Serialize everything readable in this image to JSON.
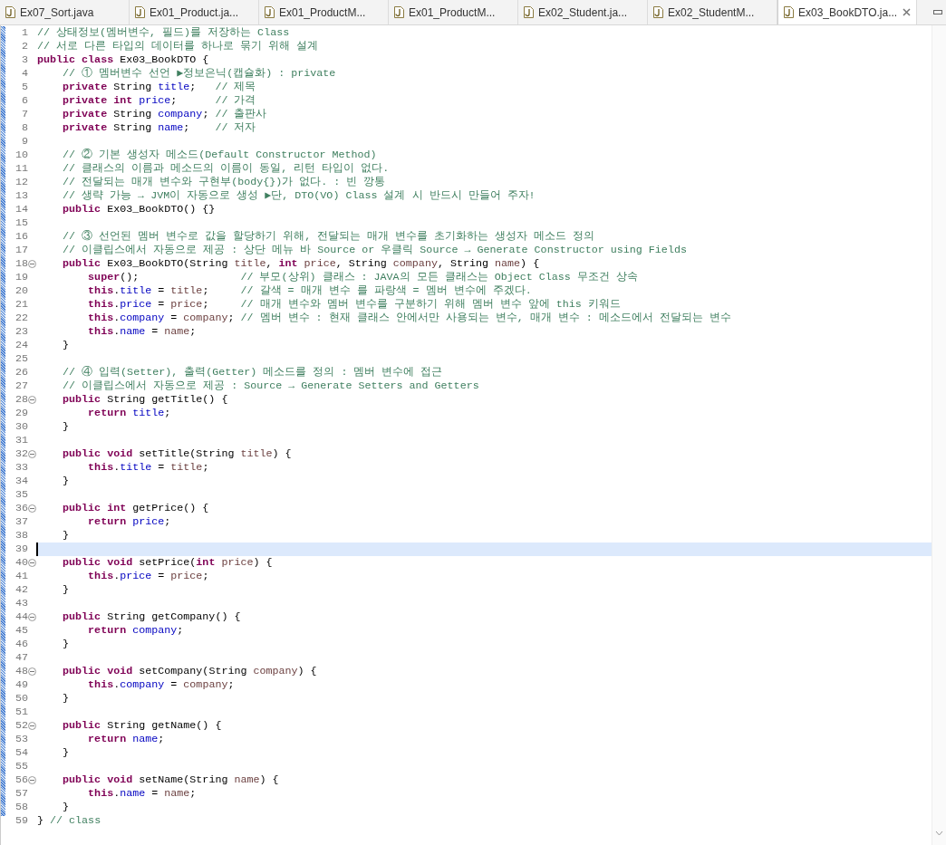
{
  "tabs": [
    {
      "label": "Ex07_Sort.java",
      "selected": false
    },
    {
      "label": "Ex01_Product.ja...",
      "selected": false
    },
    {
      "label": "Ex01_ProductM...",
      "selected": false
    },
    {
      "label": "Ex01_ProductM...",
      "selected": false
    },
    {
      "label": "Ex02_Student.ja...",
      "selected": false
    },
    {
      "label": "Ex02_StudentM...",
      "selected": false
    },
    {
      "label": "Ex03_BookDTO.ja...",
      "selected": true
    }
  ],
  "editor": {
    "lines": [
      {
        "number": "1",
        "fold": false,
        "current": false,
        "tokens": [
          {
            "kind": "comment",
            "text": "// 상태정보(멤버변수, 필드)를 저장하는 Class"
          }
        ]
      },
      {
        "number": "2",
        "fold": false,
        "current": false,
        "tokens": [
          {
            "kind": "comment",
            "text": "// 서로 다른 타입의 데이터를 하나로 묶기 위해 설계"
          }
        ]
      },
      {
        "number": "3",
        "fold": false,
        "current": false,
        "tokens": [
          {
            "kind": "keyword",
            "text": "public class"
          },
          {
            "kind": "plain",
            "text": " Ex03_BookDTO {"
          }
        ]
      },
      {
        "number": "4",
        "fold": false,
        "current": false,
        "tokens": [
          {
            "kind": "comment",
            "text": "    // ① 멤버변수 선언 ▶정보은닉(캡슐화) : private"
          }
        ]
      },
      {
        "number": "5",
        "fold": false,
        "current": false,
        "tokens": [
          {
            "kind": "keyword",
            "text": "    private"
          },
          {
            "kind": "plain",
            "text": " String "
          },
          {
            "kind": "field",
            "text": "title"
          },
          {
            "kind": "plain",
            "text": ";   "
          },
          {
            "kind": "comment",
            "text": "// 제목"
          }
        ]
      },
      {
        "number": "6",
        "fold": false,
        "current": false,
        "tokens": [
          {
            "kind": "keyword",
            "text": "    private int"
          },
          {
            "kind": "field",
            "text": " price"
          },
          {
            "kind": "plain",
            "text": ";      "
          },
          {
            "kind": "comment",
            "text": "// 가격"
          }
        ]
      },
      {
        "number": "7",
        "fold": false,
        "current": false,
        "tokens": [
          {
            "kind": "keyword",
            "text": "    private"
          },
          {
            "kind": "plain",
            "text": " String "
          },
          {
            "kind": "field",
            "text": "company"
          },
          {
            "kind": "plain",
            "text": "; "
          },
          {
            "kind": "comment",
            "text": "// 출판사"
          }
        ]
      },
      {
        "number": "8",
        "fold": false,
        "current": false,
        "tokens": [
          {
            "kind": "keyword",
            "text": "    private"
          },
          {
            "kind": "plain",
            "text": " String "
          },
          {
            "kind": "field",
            "text": "name"
          },
          {
            "kind": "plain",
            "text": ";    "
          },
          {
            "kind": "comment",
            "text": "// 저자"
          }
        ]
      },
      {
        "number": "9",
        "fold": false,
        "current": false
      },
      {
        "number": "10",
        "fold": false,
        "current": false,
        "tokens": [
          {
            "kind": "comment",
            "text": "    // ② 기본 생성자 메소드(Default Constructor Method)"
          }
        ]
      },
      {
        "number": "11",
        "fold": false,
        "current": false,
        "tokens": [
          {
            "kind": "comment",
            "text": "    // 클래스의 이름과 메소드의 이름이 동일, 리턴 타입이 없다."
          }
        ]
      },
      {
        "number": "12",
        "fold": false,
        "current": false,
        "tokens": [
          {
            "kind": "comment",
            "text": "    // 전달되는 매개 변수와 구현부(body{})가 없다. : 빈 깡통"
          }
        ]
      },
      {
        "number": "13",
        "fold": false,
        "current": false,
        "tokens": [
          {
            "kind": "comment",
            "text": "    // 생략 가능 → JVM이 자동으로 생성 ▶단, DTO(VO) Class 설계 시 반드시 만들어 주자!"
          }
        ]
      },
      {
        "number": "14",
        "fold": false,
        "current": false,
        "tokens": [
          {
            "kind": "keyword",
            "text": "    public"
          },
          {
            "kind": "plain",
            "text": " Ex03_BookDTO() {}"
          }
        ]
      },
      {
        "number": "15",
        "fold": false,
        "current": false
      },
      {
        "number": "16",
        "fold": false,
        "current": false,
        "tokens": [
          {
            "kind": "comment",
            "text": "    // ③ 선언된 멤버 변수로 값을 할당하기 위해, 전달되는 매개 변수를 초기화하는 생성자 메소드 정의"
          }
        ]
      },
      {
        "number": "17",
        "fold": false,
        "current": false,
        "tokens": [
          {
            "kind": "comment",
            "text": "    // 이클립스에서 자동으로 제공 : 상단 메뉴 바 Source or 우클릭 Source → Generate Constructor using Fields"
          }
        ]
      },
      {
        "number": "18",
        "fold": true,
        "current": false,
        "tokens": [
          {
            "kind": "keyword",
            "text": "    public"
          },
          {
            "kind": "plain",
            "text": " Ex03_BookDTO(String "
          },
          {
            "kind": "local",
            "text": "title"
          },
          {
            "kind": "plain",
            "text": ", "
          },
          {
            "kind": "keyword",
            "text": "int"
          },
          {
            "kind": "local",
            "text": " price"
          },
          {
            "kind": "plain",
            "text": ", String "
          },
          {
            "kind": "local",
            "text": "company"
          },
          {
            "kind": "plain",
            "text": ", String "
          },
          {
            "kind": "local",
            "text": "name"
          },
          {
            "kind": "plain",
            "text": ") {"
          }
        ]
      },
      {
        "number": "19",
        "fold": false,
        "current": false,
        "tokens": [
          {
            "kind": "keyword",
            "text": "        super"
          },
          {
            "kind": "plain",
            "text": "();                "
          },
          {
            "kind": "comment",
            "text": "// 부모(상위) 클래스 : JAVA의 모든 클래스는 Object Class 무조건 상속"
          }
        ]
      },
      {
        "number": "20",
        "fold": false,
        "current": false,
        "tokens": [
          {
            "kind": "keyword",
            "text": "        this"
          },
          {
            "kind": "plain",
            "text": "."
          },
          {
            "kind": "field",
            "text": "title"
          },
          {
            "kind": "plain",
            "text": " = "
          },
          {
            "kind": "local",
            "text": "title"
          },
          {
            "kind": "plain",
            "text": ";     "
          },
          {
            "kind": "comment",
            "text": "// 갈색 = 매개 변수 를 파랑색 = 멤버 변수에 주겠다."
          }
        ]
      },
      {
        "number": "21",
        "fold": false,
        "current": false,
        "tokens": [
          {
            "kind": "keyword",
            "text": "        this"
          },
          {
            "kind": "plain",
            "text": "."
          },
          {
            "kind": "field",
            "text": "price"
          },
          {
            "kind": "plain",
            "text": " = "
          },
          {
            "kind": "local",
            "text": "price"
          },
          {
            "kind": "plain",
            "text": ";     "
          },
          {
            "kind": "comment",
            "text": "// 매개 변수와 멤버 변수를 구분하기 위해 멤버 변수 앞에 this 키워드"
          }
        ]
      },
      {
        "number": "22",
        "fold": false,
        "current": false,
        "tokens": [
          {
            "kind": "keyword",
            "text": "        this"
          },
          {
            "kind": "plain",
            "text": "."
          },
          {
            "kind": "field",
            "text": "company"
          },
          {
            "kind": "plain",
            "text": " = "
          },
          {
            "kind": "local",
            "text": "company"
          },
          {
            "kind": "plain",
            "text": "; "
          },
          {
            "kind": "comment",
            "text": "// 멤버 변수 : 현재 클래스 안에서만 사용되는 변수, 매개 변수 : 메소드에서 전달되는 변수"
          }
        ]
      },
      {
        "number": "23",
        "fold": false,
        "current": false,
        "tokens": [
          {
            "kind": "keyword",
            "text": "        this"
          },
          {
            "kind": "plain",
            "text": "."
          },
          {
            "kind": "field",
            "text": "name"
          },
          {
            "kind": "plain",
            "text": " = "
          },
          {
            "kind": "local",
            "text": "name"
          },
          {
            "kind": "plain",
            "text": ";"
          }
        ]
      },
      {
        "number": "24",
        "fold": false,
        "current": false,
        "tokens": [
          {
            "kind": "plain",
            "text": "    }"
          }
        ]
      },
      {
        "number": "25",
        "fold": false,
        "current": false
      },
      {
        "number": "26",
        "fold": false,
        "current": false,
        "tokens": [
          {
            "kind": "comment",
            "text": "    // ④ 입력(Setter), 출력(Getter) 메소드를 정의 : 멤버 변수에 접근"
          }
        ]
      },
      {
        "number": "27",
        "fold": false,
        "current": false,
        "tokens": [
          {
            "kind": "comment",
            "text": "    // 이클립스에서 자동으로 제공 : Source → Generate Setters and Getters"
          }
        ]
      },
      {
        "number": "28",
        "fold": true,
        "current": false,
        "tokens": [
          {
            "kind": "keyword",
            "text": "    public"
          },
          {
            "kind": "plain",
            "text": " String getTitle() {"
          }
        ]
      },
      {
        "number": "29",
        "fold": false,
        "current": false,
        "tokens": [
          {
            "kind": "keyword",
            "text": "        return"
          },
          {
            "kind": "field",
            "text": " title"
          },
          {
            "kind": "plain",
            "text": ";"
          }
        ]
      },
      {
        "number": "30",
        "fold": false,
        "current": false,
        "tokens": [
          {
            "kind": "plain",
            "text": "    }"
          }
        ]
      },
      {
        "number": "31",
        "fold": false,
        "current": false
      },
      {
        "number": "32",
        "fold": true,
        "current": false,
        "tokens": [
          {
            "kind": "keyword",
            "text": "    public void"
          },
          {
            "kind": "plain",
            "text": " setTitle(String "
          },
          {
            "kind": "local",
            "text": "title"
          },
          {
            "kind": "plain",
            "text": ") {"
          }
        ]
      },
      {
        "number": "33",
        "fold": false,
        "current": false,
        "tokens": [
          {
            "kind": "keyword",
            "text": "        this"
          },
          {
            "kind": "plain",
            "text": "."
          },
          {
            "kind": "field",
            "text": "title"
          },
          {
            "kind": "plain",
            "text": " = "
          },
          {
            "kind": "local",
            "text": "title"
          },
          {
            "kind": "plain",
            "text": ";"
          }
        ]
      },
      {
        "number": "34",
        "fold": false,
        "current": false,
        "tokens": [
          {
            "kind": "plain",
            "text": "    }"
          }
        ]
      },
      {
        "number": "35",
        "fold": false,
        "current": false
      },
      {
        "number": "36",
        "fold": true,
        "current": false,
        "tokens": [
          {
            "kind": "keyword",
            "text": "    public int"
          },
          {
            "kind": "plain",
            "text": " getPrice() {"
          }
        ]
      },
      {
        "number": "37",
        "fold": false,
        "current": false,
        "tokens": [
          {
            "kind": "keyword",
            "text": "        return"
          },
          {
            "kind": "field",
            "text": " price"
          },
          {
            "kind": "plain",
            "text": ";"
          }
        ]
      },
      {
        "number": "38",
        "fold": false,
        "current": false,
        "tokens": [
          {
            "kind": "plain",
            "text": "    }"
          }
        ]
      },
      {
        "number": "39",
        "fold": false,
        "current": true
      },
      {
        "number": "40",
        "fold": true,
        "current": false,
        "tokens": [
          {
            "kind": "keyword",
            "text": "    public void"
          },
          {
            "kind": "plain",
            "text": " setPrice("
          },
          {
            "kind": "keyword",
            "text": "int"
          },
          {
            "kind": "local",
            "text": " price"
          },
          {
            "kind": "plain",
            "text": ") {"
          }
        ]
      },
      {
        "number": "41",
        "fold": false,
        "current": false,
        "tokens": [
          {
            "kind": "keyword",
            "text": "        this"
          },
          {
            "kind": "plain",
            "text": "."
          },
          {
            "kind": "field",
            "text": "price"
          },
          {
            "kind": "plain",
            "text": " = "
          },
          {
            "kind": "local",
            "text": "price"
          },
          {
            "kind": "plain",
            "text": ";"
          }
        ]
      },
      {
        "number": "42",
        "fold": false,
        "current": false,
        "tokens": [
          {
            "kind": "plain",
            "text": "    }"
          }
        ]
      },
      {
        "number": "43",
        "fold": false,
        "current": false
      },
      {
        "number": "44",
        "fold": true,
        "current": false,
        "tokens": [
          {
            "kind": "keyword",
            "text": "    public"
          },
          {
            "kind": "plain",
            "text": " String getCompany() {"
          }
        ]
      },
      {
        "number": "45",
        "fold": false,
        "current": false,
        "tokens": [
          {
            "kind": "keyword",
            "text": "        return"
          },
          {
            "kind": "field",
            "text": " company"
          },
          {
            "kind": "plain",
            "text": ";"
          }
        ]
      },
      {
        "number": "46",
        "fold": false,
        "current": false,
        "tokens": [
          {
            "kind": "plain",
            "text": "    }"
          }
        ]
      },
      {
        "number": "47",
        "fold": false,
        "current": false
      },
      {
        "number": "48",
        "fold": true,
        "current": false,
        "tokens": [
          {
            "kind": "keyword",
            "text": "    public void"
          },
          {
            "kind": "plain",
            "text": " setCompany(String "
          },
          {
            "kind": "local",
            "text": "company"
          },
          {
            "kind": "plain",
            "text": ") {"
          }
        ]
      },
      {
        "number": "49",
        "fold": false,
        "current": false,
        "tokens": [
          {
            "kind": "keyword",
            "text": "        this"
          },
          {
            "kind": "plain",
            "text": "."
          },
          {
            "kind": "field",
            "text": "company"
          },
          {
            "kind": "plain",
            "text": " = "
          },
          {
            "kind": "local",
            "text": "company"
          },
          {
            "kind": "plain",
            "text": ";"
          }
        ]
      },
      {
        "number": "50",
        "fold": false,
        "current": false,
        "tokens": [
          {
            "kind": "plain",
            "text": "    }"
          }
        ]
      },
      {
        "number": "51",
        "fold": false,
        "current": false
      },
      {
        "number": "52",
        "fold": true,
        "current": false,
        "tokens": [
          {
            "kind": "keyword",
            "text": "    public"
          },
          {
            "kind": "plain",
            "text": " String getName() {"
          }
        ]
      },
      {
        "number": "53",
        "fold": false,
        "current": false,
        "tokens": [
          {
            "kind": "keyword",
            "text": "        return"
          },
          {
            "kind": "field",
            "text": " name"
          },
          {
            "kind": "plain",
            "text": ";"
          }
        ]
      },
      {
        "number": "54",
        "fold": false,
        "current": false,
        "tokens": [
          {
            "kind": "plain",
            "text": "    }"
          }
        ]
      },
      {
        "number": "55",
        "fold": false,
        "current": false
      },
      {
        "number": "56",
        "fold": true,
        "current": false,
        "tokens": [
          {
            "kind": "keyword",
            "text": "    public void"
          },
          {
            "kind": "plain",
            "text": " setName(String "
          },
          {
            "kind": "local",
            "text": "name"
          },
          {
            "kind": "plain",
            "text": ") {"
          }
        ]
      },
      {
        "number": "57",
        "fold": false,
        "current": false,
        "tokens": [
          {
            "kind": "keyword",
            "text": "        this"
          },
          {
            "kind": "plain",
            "text": "."
          },
          {
            "kind": "field",
            "text": "name"
          },
          {
            "kind": "plain",
            "text": " = "
          },
          {
            "kind": "local",
            "text": "name"
          },
          {
            "kind": "plain",
            "text": ";"
          }
        ]
      },
      {
        "number": "58",
        "fold": false,
        "current": false,
        "tokens": [
          {
            "kind": "plain",
            "text": "    }"
          }
        ]
      },
      {
        "number": "59",
        "fold": false,
        "current": false,
        "tokens": [
          {
            "kind": "plain",
            "text": "} "
          },
          {
            "kind": "comment",
            "text": "// class"
          }
        ]
      }
    ]
  }
}
